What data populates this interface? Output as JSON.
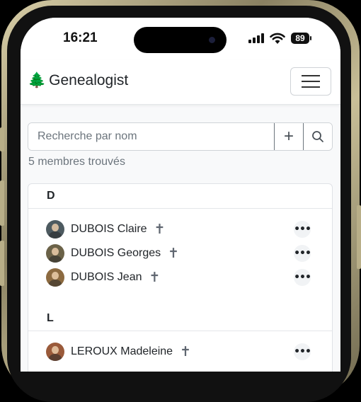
{
  "status_bar": {
    "time": "16:21",
    "battery": "89"
  },
  "navbar": {
    "brand_icon": "🌲",
    "brand_title": "Genealogist"
  },
  "search": {
    "placeholder": "Recherche par nom",
    "add_label": "+"
  },
  "results": {
    "count_text": "5 membres trouvés"
  },
  "groups": [
    {
      "letter": "D",
      "members": [
        {
          "name": "DUBOIS Claire",
          "deceased_mark": "✝",
          "more": "•••",
          "avatar_color": "#4d5a60"
        },
        {
          "name": "DUBOIS Georges",
          "deceased_mark": "✝",
          "more": "•••",
          "avatar_color": "#6b6248"
        },
        {
          "name": "DUBOIS Jean",
          "deceased_mark": "✝",
          "more": "•••",
          "avatar_color": "#8c6a40"
        }
      ]
    },
    {
      "letter": "L",
      "members": [
        {
          "name": "LEROUX Madeleine",
          "deceased_mark": "✝",
          "more": "•••",
          "avatar_color": "#9a5a3a"
        }
      ]
    }
  ],
  "colors": {
    "accent": "#212529",
    "muted": "#6c757d",
    "frame_gold": "#c9bf98"
  }
}
